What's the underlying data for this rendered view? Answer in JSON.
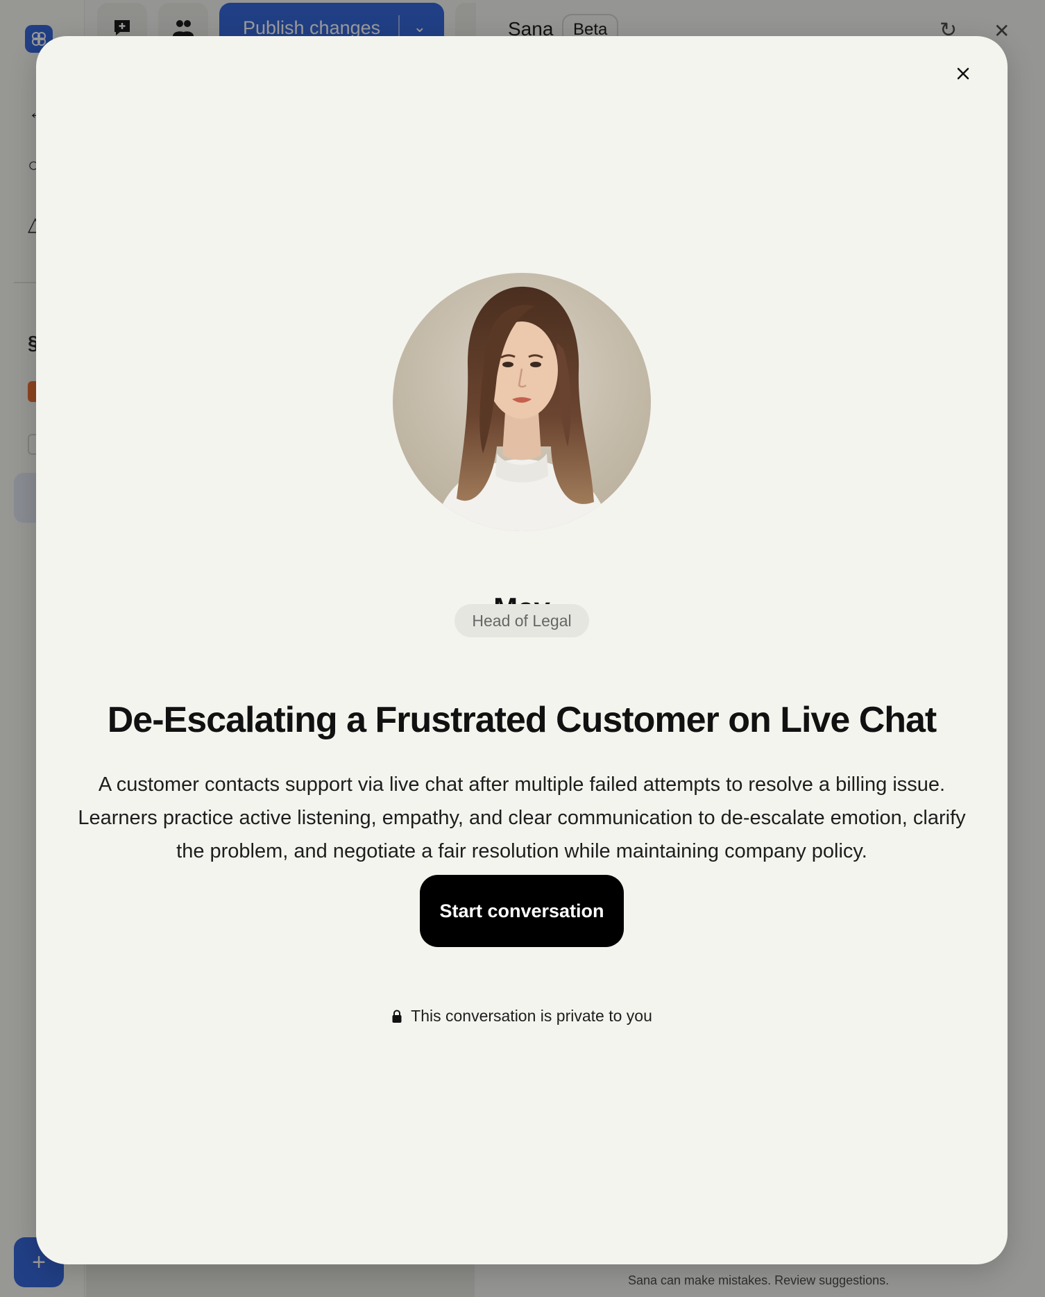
{
  "background": {
    "toolbar": {
      "publish_label": "Publish changes"
    },
    "assistant_panel": {
      "title": "Sana",
      "badge": "Beta",
      "disclaimer": "Sana can make mistakes. Review suggestions."
    },
    "sidebar": {
      "add_button_symbol": "+"
    },
    "colors": {
      "accent": "#2b5fd8",
      "overlay": "rgba(20,20,20,0.42)"
    }
  },
  "modal": {
    "persona": {
      "name": "May",
      "role": "Head of Legal",
      "avatar": "portrait-photo"
    },
    "scenario_title": "De-Escalating a Frustrated Customer on Live Chat",
    "description": "A customer contacts support via live chat after multiple failed attempts to resolve a billing issue. Learners practice active listening, empathy, and clear communication to de-escalate emotion, clarify the problem, and negotiate a fair resolution while maintaining company policy.",
    "start_button_label": "Start conversation",
    "privacy_note": "This conversation is private to you",
    "icons": {
      "close": "close-icon",
      "privacy": "lock-icon"
    },
    "colors": {
      "surface": "#f4f4ef",
      "button": "#000000",
      "badge_bg": "#e6e6e1"
    }
  }
}
